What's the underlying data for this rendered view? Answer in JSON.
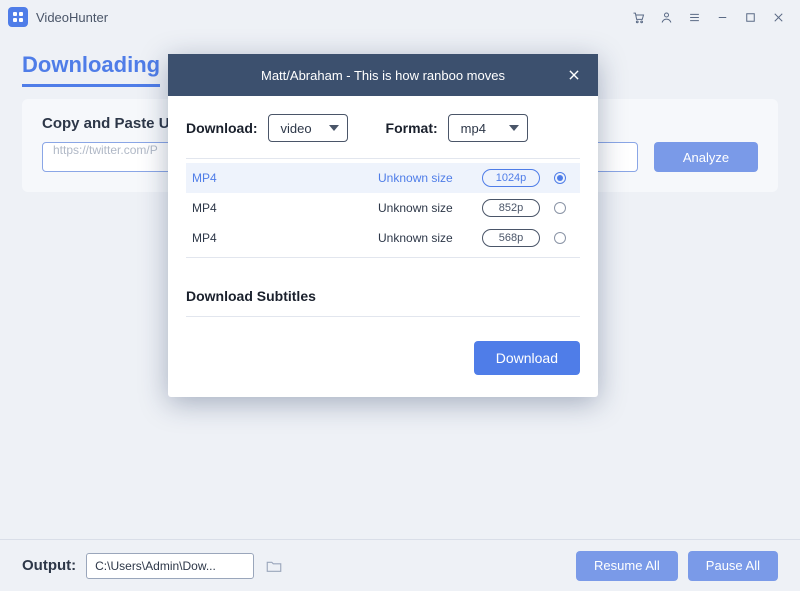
{
  "app": {
    "name": "VideoHunter"
  },
  "tabs": {
    "downloading": "Downloading"
  },
  "card": {
    "title": "Copy and Paste U",
    "url_truncated": "https://twitter.com/P",
    "analyze": "Analyze"
  },
  "footer": {
    "output_label": "Output:",
    "output_path": "C:\\Users\\Admin\\Dow...",
    "resume": "Resume All",
    "pause": "Pause All"
  },
  "modal": {
    "title": "Matt/Abraham - This is how ranboo moves",
    "download_label": "Download:",
    "download_value": "video",
    "format_label": "Format:",
    "format_value": "mp4",
    "qualities": [
      {
        "format": "MP4",
        "size": "Unknown size",
        "res": "1024p",
        "selected": true
      },
      {
        "format": "MP4",
        "size": "Unknown size",
        "res": "852p",
        "selected": false
      },
      {
        "format": "MP4",
        "size": "Unknown size",
        "res": "568p",
        "selected": false
      }
    ],
    "subtitles_label": "Download Subtitles",
    "download_btn": "Download"
  }
}
